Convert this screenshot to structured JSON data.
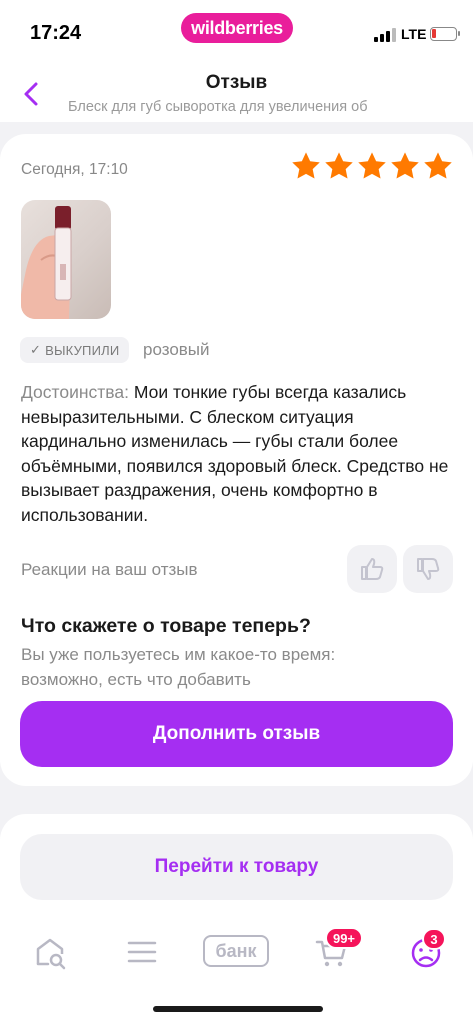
{
  "status": {
    "time": "17:24",
    "brand": "wildberries",
    "network": "LTE"
  },
  "nav": {
    "title": "Отзыв",
    "subtitle": "Блеск для губ сыворотка для увеличения об"
  },
  "review": {
    "date": "Сегодня, 17:10",
    "rating": 5,
    "bought_chip": "ВЫКУПИЛИ",
    "color": "розовый",
    "text_label": "Достоинства:",
    "text": "Мои тонкие губы всегда казались невыразительными. С блеском ситуация кардинально изменилась — губы стали более объёмными, появился здоровый блеск. Средство не вызывает раздражения, очень комфортно в использовании.",
    "reactions_label": "Реакции на ваш отзыв"
  },
  "followup": {
    "title": "Что скажете о товаре теперь?",
    "subtitle": "Вы уже пользуетесь им какое-то время: возможно, есть что добавить",
    "button": "Дополнить отзыв"
  },
  "goto_product": "Перейти к товару",
  "tabbar": {
    "bank_label": "банк",
    "cart_badge": "99+",
    "profile_badge": "3"
  },
  "colors": {
    "accent": "#a52ef2",
    "star": "#ff7a00",
    "badge": "#f5145a",
    "brand": "#e91e9b"
  },
  "icons": [
    "back-chevron-icon",
    "star-icon",
    "checkmark-icon",
    "thumbs-up-icon",
    "thumbs-down-icon",
    "home-search-icon",
    "menu-icon",
    "cart-icon",
    "profile-icon"
  ]
}
